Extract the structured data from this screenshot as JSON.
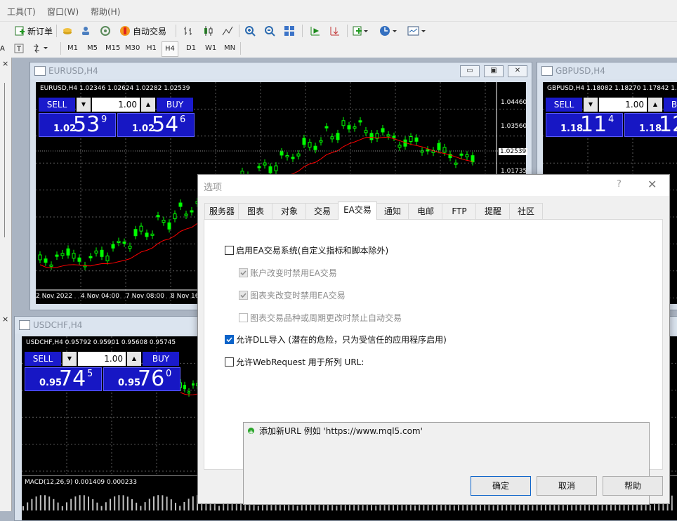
{
  "menu": {
    "items": [
      "工具(T)",
      "窗口(W)",
      "帮助(H)"
    ]
  },
  "toolbar": {
    "new_order": "新订单",
    "auto_trading": "自动交易"
  },
  "timeframes": [
    "M1",
    "M5",
    "M15",
    "M30",
    "H1",
    "H4",
    "D1",
    "W1",
    "MN"
  ],
  "active_timeframe": "H4",
  "charts": {
    "eurusd": {
      "window_title": "EURUSD,H4",
      "symbol_line": "EURUSD,H4  1.02346 1.02624 1.02282 1.02539",
      "sell": "SELL",
      "buy": "BUY",
      "lot": "1.00",
      "sell_small": "1.02",
      "sell_big": "53",
      "sell_sup": "9",
      "buy_small": "1.02",
      "buy_big": "54",
      "buy_sup": "6",
      "prices": [
        "1.04460",
        "1.03560",
        "1.02539",
        "1.01735"
      ],
      "times": [
        "2 Nov 2022",
        "4 Nov 04:00",
        "7 Nov 08:00",
        "8 Nov 16"
      ]
    },
    "gbpusd": {
      "window_title": "GBPUSD,H4",
      "symbol_line": "GBPUSD,H4  1.18082 1.18270 1.17842 1.18",
      "sell": "SELL",
      "buy": "B",
      "lot": "1.00",
      "sell_small": "1.18",
      "sell_big": "11",
      "sell_sup": "4",
      "buy_small": "1.18",
      "buy_big": "12"
    },
    "usdchf": {
      "window_title": "USDCHF,H4",
      "symbol_line": "USDCHF,H4  0.95792 0.95901 0.95608 0.95745",
      "sell": "SELL",
      "buy": "BUY",
      "lot": "1.00",
      "sell_small": "0.95",
      "sell_big": "74",
      "sell_sup": "5",
      "buy_small": "0.95",
      "buy_big": "76",
      "buy_sup": "0",
      "macd_label": "MACD(12,26,9) 0.001409 0.000233"
    }
  },
  "dialog": {
    "title": "选项",
    "help": "?",
    "tabs": [
      "服务器",
      "图表",
      "对象",
      "交易",
      "EA交易",
      "通知",
      "电邮",
      "FTP",
      "提醒",
      "社区"
    ],
    "active_tab": "EA交易",
    "options": {
      "enable_ea": {
        "label": "启用EA交易系统(自定义指标和脚本除外)",
        "checked": false
      },
      "disable_on_account_change": {
        "label": "账户改变时禁用EA交易",
        "checked": true,
        "disabled": true
      },
      "disable_on_profile_change": {
        "label": "图表夹改变时禁用EA交易",
        "checked": true,
        "disabled": true
      },
      "disable_on_symbol_change": {
        "label": "图表交易品种或周期更改时禁止自动交易",
        "checked": false,
        "disabled": true
      },
      "allow_dll": {
        "label": "允许DLL导入 (潜在的危险，只为受信任的应用程序启用)",
        "checked": true
      },
      "allow_webrequest": {
        "label": "允许WebRequest 用于所列 URL:",
        "checked": false
      }
    },
    "add_url": "添加新URL 例如 'https://www.mql5.com'",
    "buttons": {
      "ok": "确定",
      "cancel": "取消",
      "help": "帮助"
    }
  },
  "colors": {
    "chart_bg": "#000000",
    "candle": "#00ff00",
    "ma_line": "#ff0000",
    "trade_blue": "#1a1acc",
    "check_blue": "#0b63c9"
  }
}
